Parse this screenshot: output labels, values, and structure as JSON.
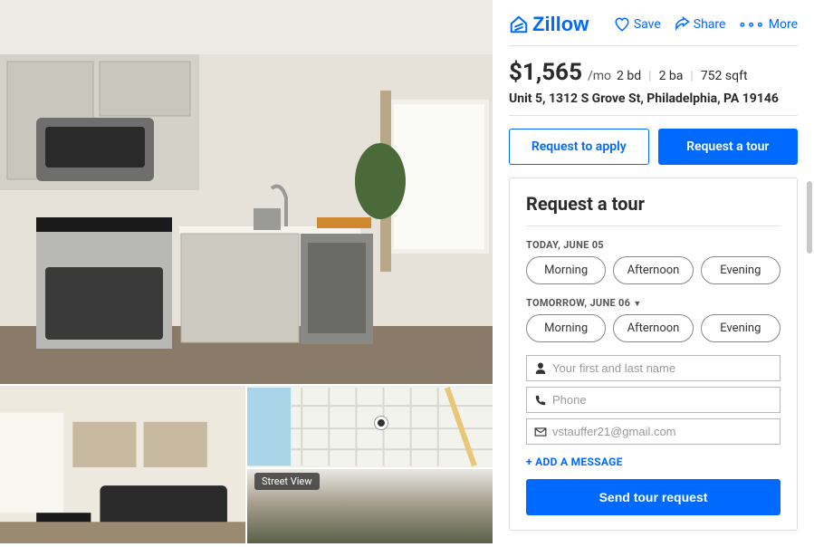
{
  "logo": {
    "text": "Zillow"
  },
  "header": {
    "save": "Save",
    "share": "Share",
    "more": "More"
  },
  "listing": {
    "price": "$1,565",
    "price_suffix": "/mo",
    "beds": "2 bd",
    "baths": "2 ba",
    "sqft": "752 sqft",
    "address": "Unit 5, 1312 S Grove St, Philadelphia, PA 19146"
  },
  "cta": {
    "apply": "Request to apply",
    "tour": "Request a tour"
  },
  "tour": {
    "title": "Request a tour",
    "today_label": "TODAY, JUNE 05",
    "tomorrow_label": "TOMORROW, JUNE 06",
    "slots": {
      "morning": "Morning",
      "afternoon": "Afternoon",
      "evening": "Evening"
    },
    "name_placeholder": "Your first and last name",
    "phone_placeholder": "Phone",
    "email_value": "vstauffer21@gmail.com",
    "add_message": "+ ADD A MESSAGE",
    "send": "Send tour request"
  },
  "photos": {
    "street_view_label": "Street View"
  }
}
